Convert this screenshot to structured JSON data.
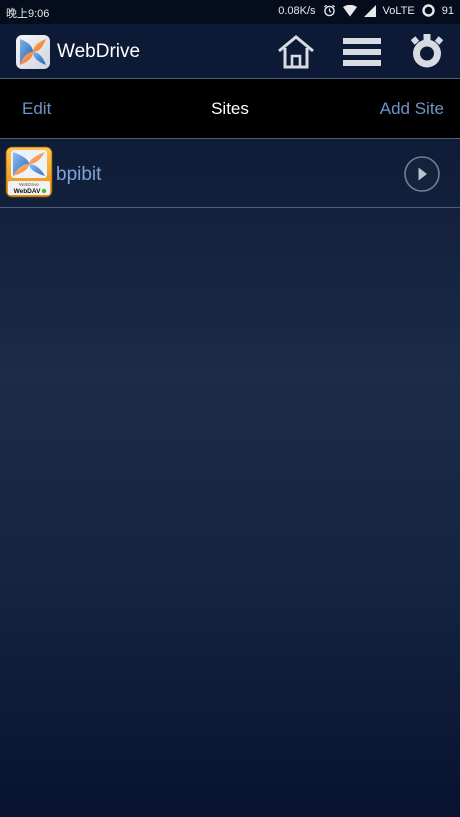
{
  "status_bar": {
    "time": "晚上9:06",
    "speed": "0.08K/s",
    "network": "VoLTE",
    "battery": "91",
    "icons": [
      "alarm-icon",
      "wifi-icon",
      "signal-icon",
      "battery-icon"
    ]
  },
  "app_bar": {
    "title": "WebDrive",
    "icons": [
      "app-logo-icon",
      "home-icon",
      "menu-icon",
      "settings-icon"
    ]
  },
  "toolbar": {
    "edit_label": "Edit",
    "title": "Sites",
    "add_label": "Add Site"
  },
  "sites": [
    {
      "name": "bpibit",
      "icon": "webdav-drive-icon",
      "icon_label_top": "WebDrive",
      "icon_label": "WebDAV"
    }
  ],
  "colors": {
    "accent": "#6f93c6",
    "site_text": "#7ea3d6",
    "toolbar_bg": "#000000",
    "app_bar_bg": "#0d1a36",
    "divider": "#4d6078"
  }
}
